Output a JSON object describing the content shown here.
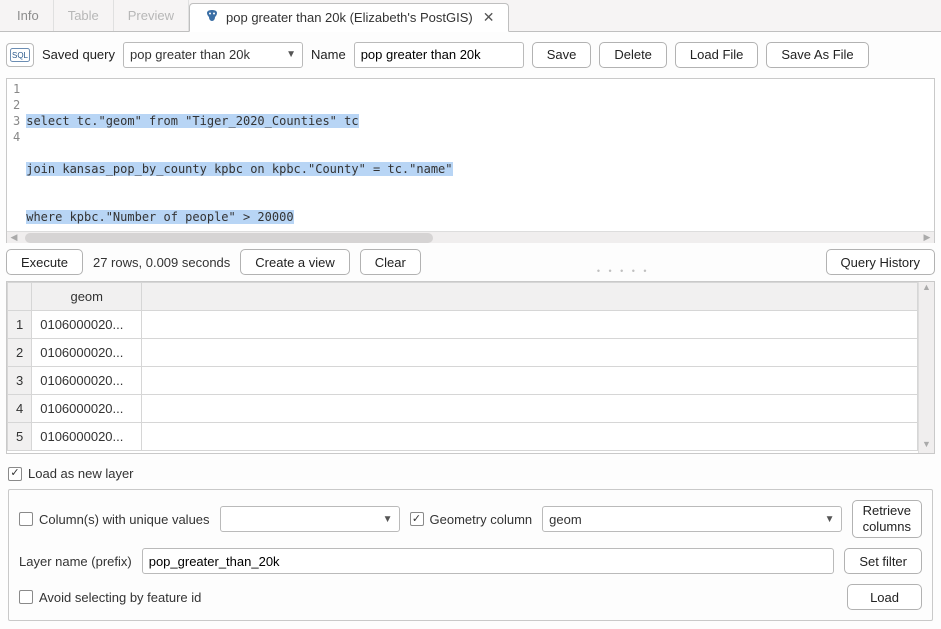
{
  "tabs": {
    "info": "Info",
    "table": "Table",
    "preview": "Preview",
    "active": "pop greater than 20k (Elizabeth's PostGIS)"
  },
  "toolbar": {
    "saved_query_label": "Saved query",
    "saved_query_value": "pop greater than 20k",
    "name_label": "Name",
    "name_value": "pop greater than 20k",
    "save": "Save",
    "delete": "Delete",
    "load_file": "Load File",
    "save_as_file": "Save As File"
  },
  "editor": {
    "linenums": [
      "1",
      "2",
      "3",
      "4"
    ],
    "lines": [
      "select tc.\"geom\" from \"Tiger_2020_Counties\" tc",
      "join kansas_pop_by_county kpbc on kpbc.\"County\" = tc.\"name\"",
      "where kpbc.\"Number of people\" > 20000",
      ""
    ]
  },
  "exec": {
    "execute": "Execute",
    "status": "27 rows, 0.009 seconds",
    "create_view": "Create a view",
    "clear": "Clear",
    "query_history": "Query History"
  },
  "table": {
    "header": "geom",
    "rows": [
      {
        "n": "1",
        "v": "0106000020..."
      },
      {
        "n": "2",
        "v": "0106000020..."
      },
      {
        "n": "3",
        "v": "0106000020..."
      },
      {
        "n": "4",
        "v": "0106000020..."
      },
      {
        "n": "5",
        "v": "0106000020..."
      }
    ]
  },
  "bottom": {
    "load_new_layer": "Load as new layer",
    "cols_unique": "Column(s) with unique values",
    "unique_value": "",
    "geom_col": "Geometry column",
    "geom_value": "geom",
    "retrieve_cols": "Retrieve\ncolumns",
    "layer_name_label": "Layer name (prefix)",
    "layer_name_value": "pop_greater_than_20k",
    "set_filter": "Set filter",
    "avoid_fid": "Avoid selecting by feature id",
    "load": "Load"
  }
}
